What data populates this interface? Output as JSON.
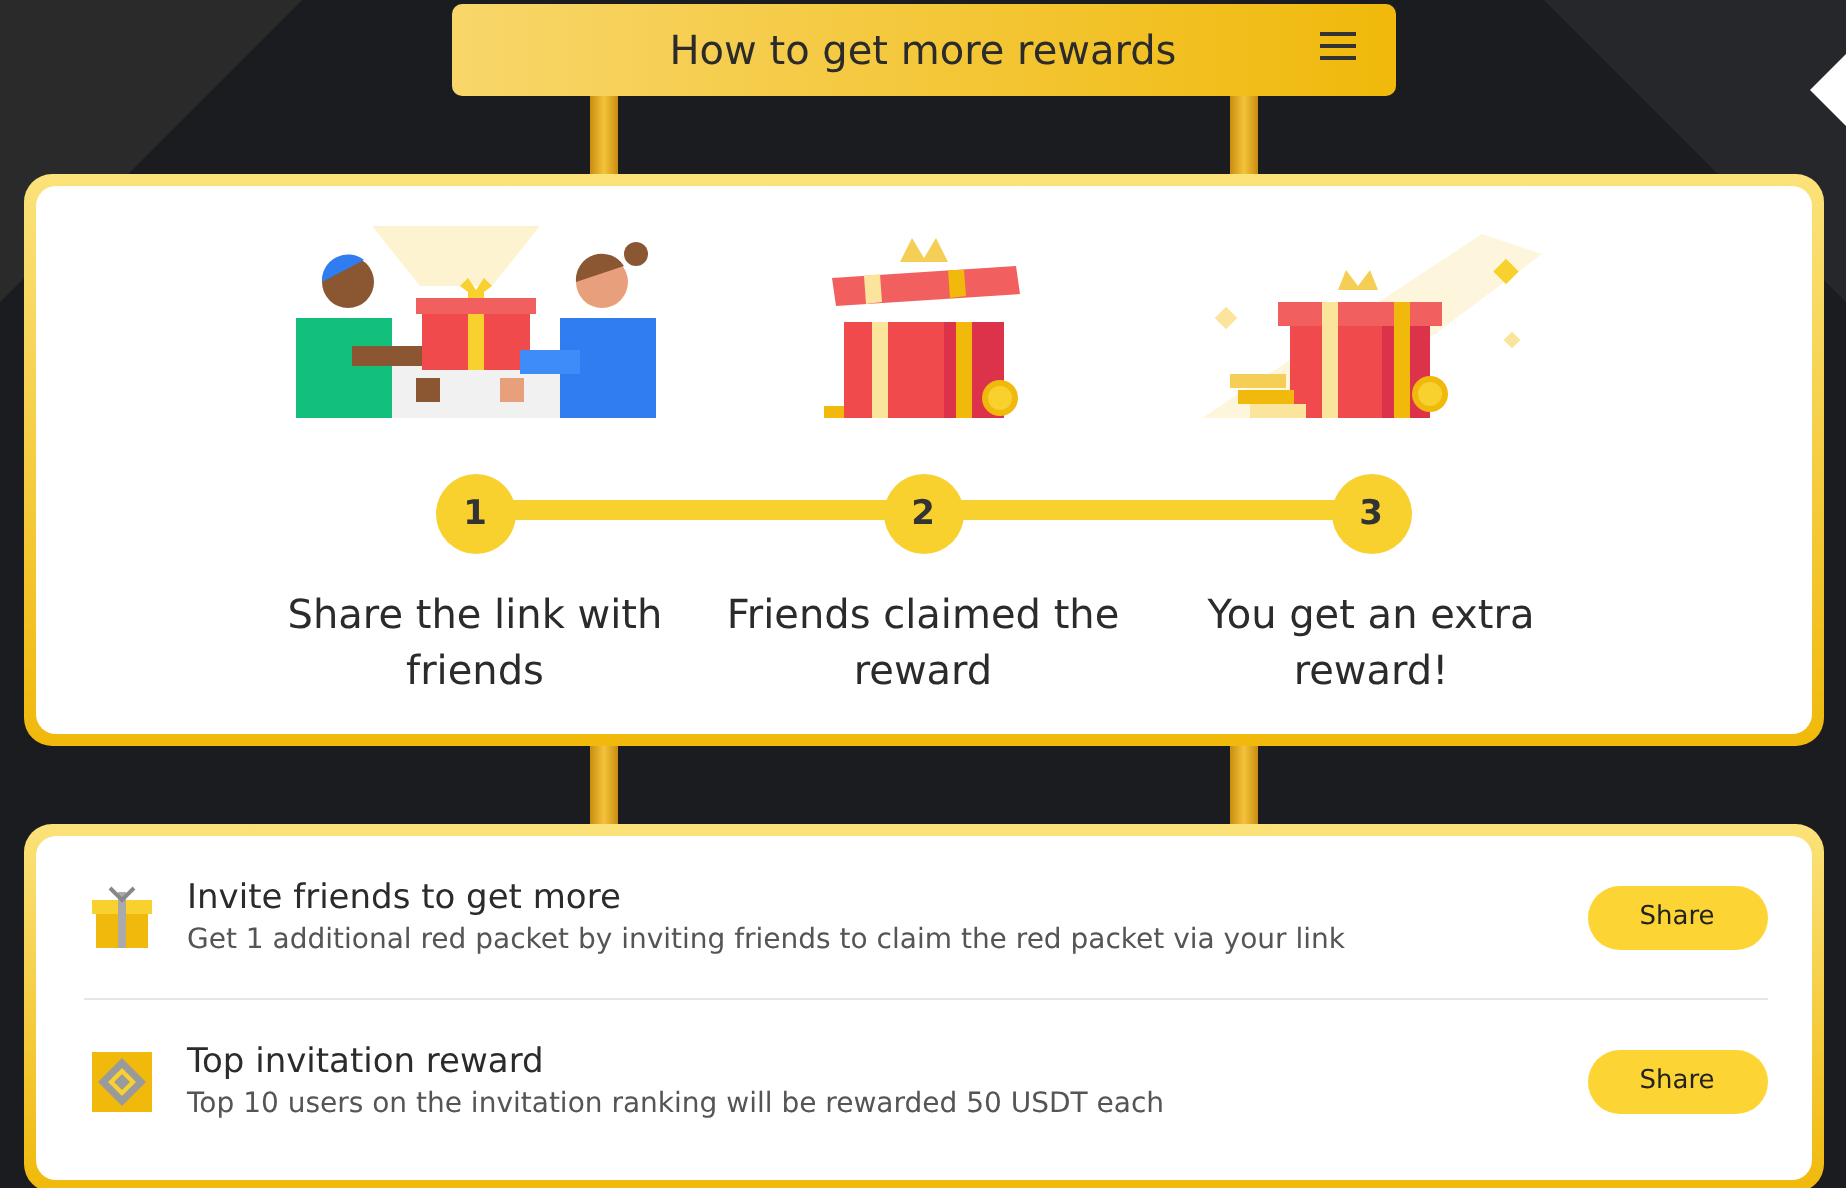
{
  "header": {
    "title": "How to get more rewards"
  },
  "steps": [
    {
      "kind": "people",
      "number": "1",
      "label": "Share the link with friends"
    },
    {
      "kind": "open-gift",
      "number": "2",
      "label": "Friends claimed the reward"
    },
    {
      "kind": "gift-coins",
      "number": "3",
      "label": "You get an extra reward!"
    }
  ],
  "tasks": [
    {
      "kind": "gift",
      "title": "Invite friends to get more",
      "description": "Get 1 additional red packet by inviting friends to claim the red packet via your link",
      "button": "Share"
    },
    {
      "kind": "ranking",
      "title": "Top invitation reward",
      "description": "Top 10 users on the invitation ranking will be rewarded 50 USDT each",
      "button": "Share"
    }
  ]
}
